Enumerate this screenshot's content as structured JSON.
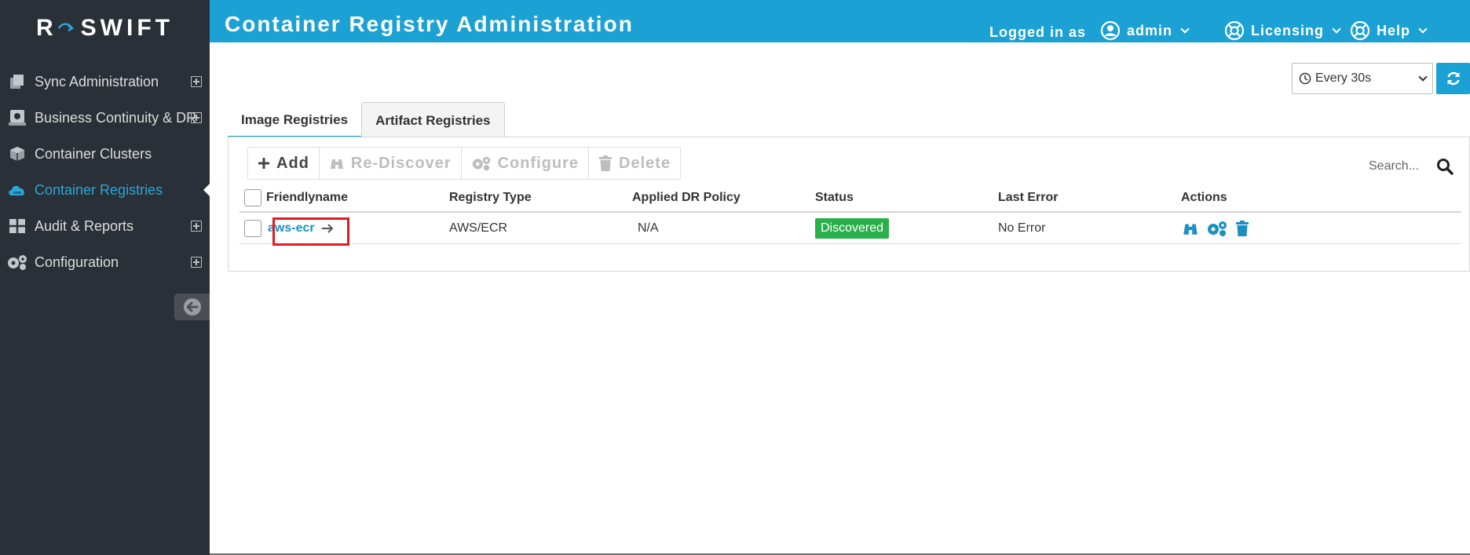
{
  "brand": {
    "name": "SWIFT",
    "mark": "R"
  },
  "sidebar": {
    "items": [
      {
        "label": "Sync Administration",
        "icon": "copy-icon",
        "expandable": true
      },
      {
        "label": "Business Continuity & DR",
        "icon": "server-icon",
        "expandable": true
      },
      {
        "label": "Container Clusters",
        "icon": "cube-icon",
        "expandable": false
      },
      {
        "label": "Container Registries",
        "icon": "cloud-icon",
        "expandable": false,
        "active": true
      },
      {
        "label": "Audit & Reports",
        "icon": "table-icon",
        "expandable": true
      },
      {
        "label": "Configuration",
        "icon": "gears-icon",
        "expandable": true
      }
    ]
  },
  "header": {
    "title": "Container Registry Administration",
    "logged_in_text": "Logged in as",
    "user": "admin",
    "licensing": "Licensing",
    "help": "Help"
  },
  "refresh": {
    "interval": "Every 30s"
  },
  "tabs": [
    {
      "label": "Image Registries",
      "active": true
    },
    {
      "label": "Artifact Registries",
      "active": false
    }
  ],
  "toolbar": {
    "add": "Add",
    "rediscover": "Re-Discover",
    "configure": "Configure",
    "delete": "Delete"
  },
  "search": {
    "placeholder": "Search..."
  },
  "table": {
    "columns": [
      "Friendlyname",
      "Registry Type",
      "Applied DR Policy",
      "Status",
      "Last Error",
      "Actions"
    ],
    "rows": [
      {
        "name": "aws-ecr",
        "type": "AWS/ECR",
        "policy": "N/A",
        "status": "Discovered",
        "last_error": "No Error"
      }
    ]
  },
  "colors": {
    "sidebar_bg": "#2a3037",
    "accent": "#1ba1d3",
    "active_nav": "#2aa6d8",
    "status_green": "#2ab04a",
    "highlight_red": "#e01b24"
  }
}
